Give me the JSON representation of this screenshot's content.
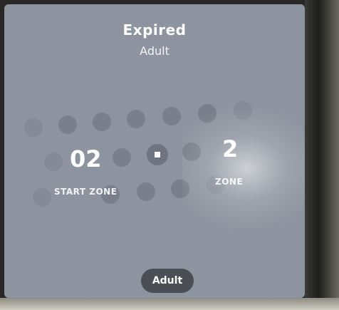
{
  "ticket": {
    "status": "Expired",
    "passenger_type": "Adult"
  },
  "zones": {
    "start_value": "02",
    "start_label": "START ZONE",
    "end_value": "2",
    "end_label": "ZONE"
  },
  "button": {
    "label": "Adult"
  },
  "colors": {
    "screen_background": "#8e949f",
    "dot": "#7a808b",
    "pill_background": "#4b4e55",
    "text": "#ffffff"
  }
}
